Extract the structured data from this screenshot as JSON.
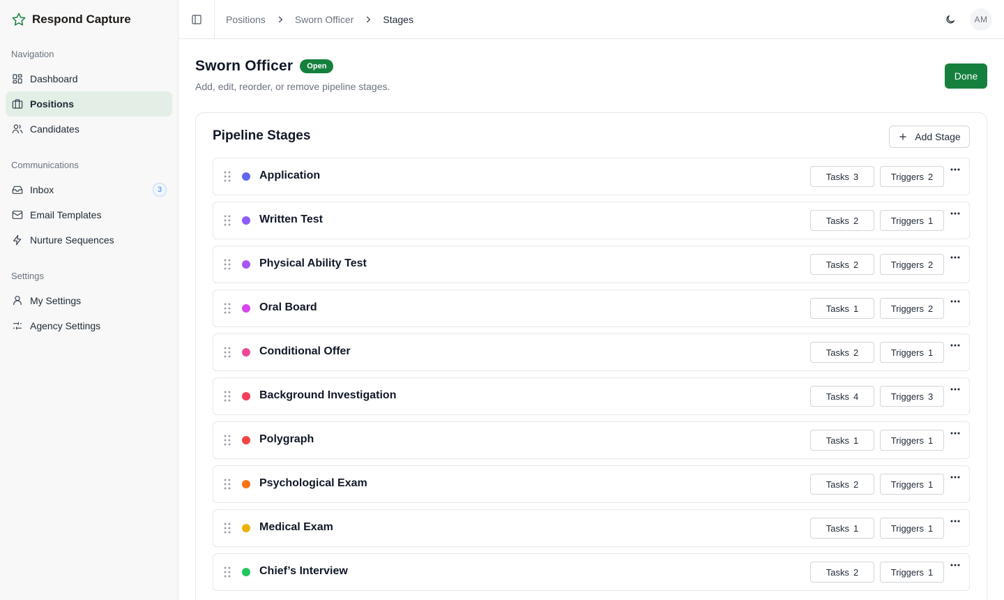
{
  "app": {
    "name": "Respond Capture",
    "logo_icon": "star-icon",
    "accent": "#15803d"
  },
  "sidebar": {
    "groups": [
      {
        "label": "Navigation",
        "items": [
          {
            "label": "Dashboard",
            "icon": "dashboard-icon",
            "active": false
          },
          {
            "label": "Positions",
            "icon": "briefcase-icon",
            "active": true
          },
          {
            "label": "Candidates",
            "icon": "users-icon",
            "active": false
          }
        ]
      },
      {
        "label": "Communications",
        "items": [
          {
            "label": "Inbox",
            "icon": "inbox-icon",
            "badge": "3"
          },
          {
            "label": "Email Templates",
            "icon": "mail-icon"
          },
          {
            "label": "Nurture Sequences",
            "icon": "zap-icon"
          }
        ]
      },
      {
        "label": "Settings",
        "items": [
          {
            "label": "My Settings",
            "icon": "user-icon"
          },
          {
            "label": "Agency Settings",
            "icon": "sliders-icon"
          }
        ]
      }
    ]
  },
  "breadcrumbs": [
    "Positions",
    "Sworn Officer",
    "Stages"
  ],
  "user": {
    "initials": "AM"
  },
  "page": {
    "title": "Sworn Officer",
    "status": "Open",
    "subtitle": "Add, edit, reorder, or remove pipeline stages.",
    "done_label": "Done"
  },
  "card": {
    "title": "Pipeline Stages",
    "add_label": "Add Stage"
  },
  "stages": [
    {
      "name": "Application",
      "color": "#6366f1",
      "tasks_label": "Tasks",
      "tasks": "3",
      "triggers_label": "Triggers",
      "triggers": "2"
    },
    {
      "name": "Written Test",
      "color": "#8b5cf6",
      "tasks_label": "Tasks",
      "tasks": "2",
      "triggers_label": "Triggers",
      "triggers": "1"
    },
    {
      "name": "Physical Ability Test",
      "color": "#a855f7",
      "tasks_label": "Tasks",
      "tasks": "2",
      "triggers_label": "Triggers",
      "triggers": "2"
    },
    {
      "name": "Oral Board",
      "color": "#d946ef",
      "tasks_label": "Tasks",
      "tasks": "1",
      "triggers_label": "Triggers",
      "triggers": "2"
    },
    {
      "name": "Conditional Offer",
      "color": "#ec4899",
      "tasks_label": "Tasks",
      "tasks": "2",
      "triggers_label": "Triggers",
      "triggers": "1"
    },
    {
      "name": "Background Investigation",
      "color": "#f43f5e",
      "tasks_label": "Tasks",
      "tasks": "4",
      "triggers_label": "Triggers",
      "triggers": "3"
    },
    {
      "name": "Polygraph",
      "color": "#ef4444",
      "tasks_label": "Tasks",
      "tasks": "1",
      "triggers_label": "Triggers",
      "triggers": "1"
    },
    {
      "name": "Psychological Exam",
      "color": "#f97316",
      "tasks_label": "Tasks",
      "tasks": "2",
      "triggers_label": "Triggers",
      "triggers": "1"
    },
    {
      "name": "Medical Exam",
      "color": "#eab308",
      "tasks_label": "Tasks",
      "tasks": "1",
      "triggers_label": "Triggers",
      "triggers": "1"
    },
    {
      "name": "Chief’s Interview",
      "color": "#22c55e",
      "tasks_label": "Tasks",
      "tasks": "2",
      "triggers_label": "Triggers",
      "triggers": "1"
    }
  ]
}
